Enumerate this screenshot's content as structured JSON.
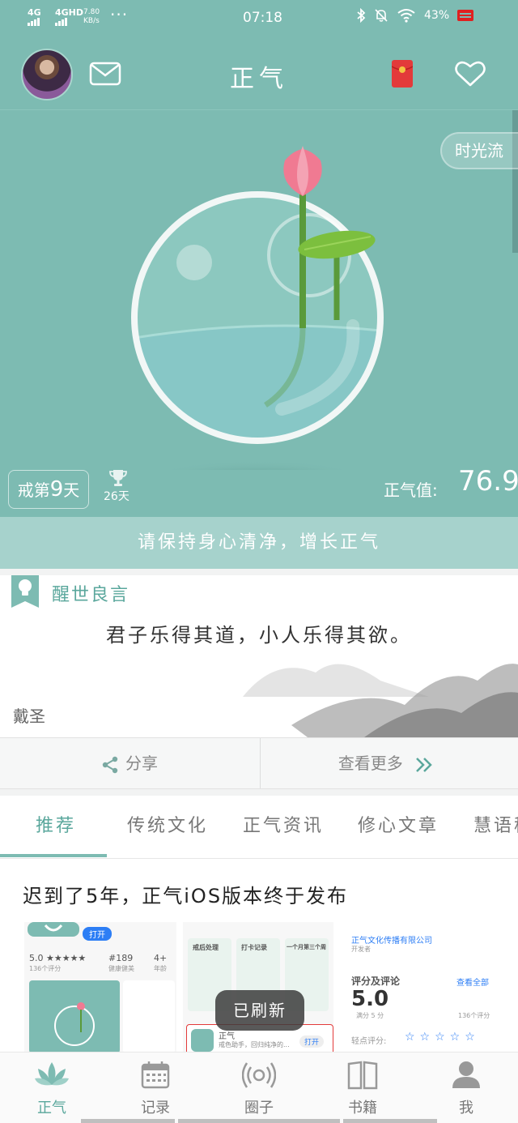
{
  "status_bar": {
    "net1": "4G",
    "net2": "4GHD",
    "speed_value": "7.80",
    "speed_unit": "KB/s",
    "dots": "···",
    "time": "07:18",
    "battery": "43%"
  },
  "header": {
    "title": "正气",
    "icons": [
      "avatar",
      "mail-icon",
      "red-packet-icon",
      "heart-icon"
    ]
  },
  "hero": {
    "time_flow_button": "时光流",
    "days_prefix": "戒第",
    "days_value": "9",
    "days_suffix": "天",
    "record": "26天",
    "zhengqi_label": "正气值:",
    "zhengqi_value": "76.9",
    "slogan": "请保持身心清净，增长正气"
  },
  "quote": {
    "section_title": "醒世良言",
    "text": "君子乐得其道，小人乐得其欲。",
    "author": "戴圣",
    "share_label": "分享",
    "more_label": "查看更多"
  },
  "tabs": [
    {
      "label": "推荐",
      "active": true
    },
    {
      "label": "传统文化",
      "active": false
    },
    {
      "label": "正气资讯",
      "active": false
    },
    {
      "label": "修心文章",
      "active": false
    },
    {
      "label": "慧语移",
      "active": false
    }
  ],
  "article": {
    "title": "迟到了5年，正气iOS版本终于发布",
    "shot1": {
      "open": "打开",
      "rating": "5.0 ★★★★★",
      "rank": "#189",
      "age": "4+",
      "sub1": "136个评分",
      "sub2": "健康健美",
      "sub3": "年龄"
    },
    "shot2": {
      "c1": "戒后处理",
      "c2": "打卡记录",
      "c3": "一个月第三个周",
      "app_name": "正气",
      "app_sub": "戒色助手，回归纯净的...",
      "open": "打开"
    },
    "shot3": {
      "company": "正气文化传播有限公司",
      "dev": "开发者",
      "reviews": "评分及评论",
      "see_all": "查看全部",
      "score": "5.0",
      "out_of": "满分 5 分",
      "count": "136个评分",
      "tap_rate": "轻点评分:"
    }
  },
  "toast": "已刷新",
  "bottom_nav": [
    {
      "label": "正气",
      "icon": "lotus-icon",
      "active": true
    },
    {
      "label": "记录",
      "icon": "calendar-icon",
      "active": false
    },
    {
      "label": "圈子",
      "icon": "broadcast-icon",
      "active": false
    },
    {
      "label": "书籍",
      "icon": "book-icon",
      "active": false
    },
    {
      "label": "我",
      "icon": "user-icon",
      "active": false
    }
  ],
  "colors": {
    "theme": "#7dbbb2",
    "accent": "#5aa79c",
    "slogan_bar": "#a6d2cc",
    "battery": "#e02020"
  }
}
